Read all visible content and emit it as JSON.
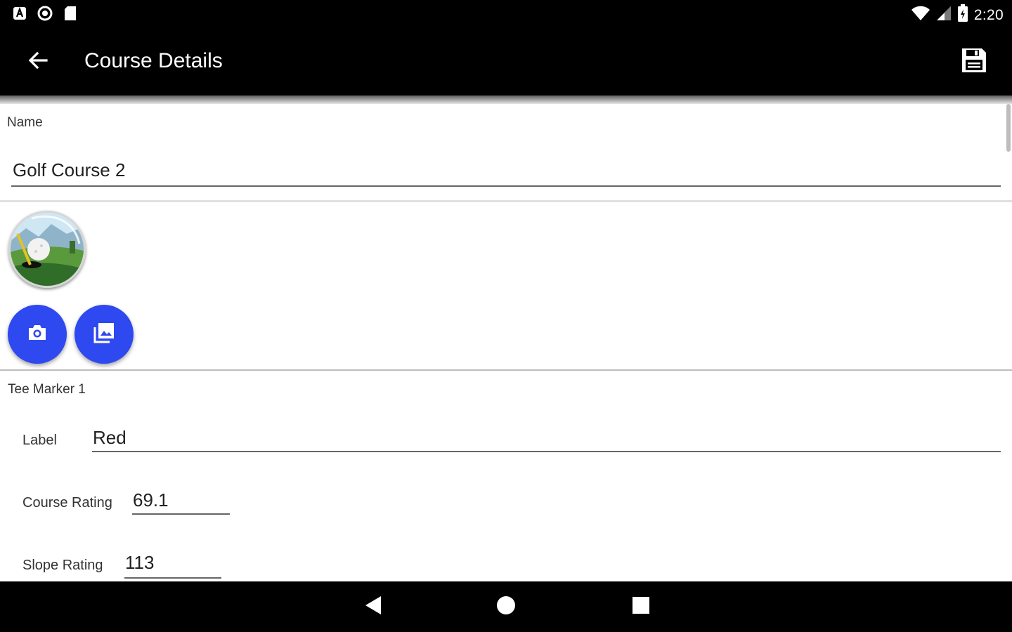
{
  "status_bar": {
    "time": "2:20",
    "left_icons": [
      "notification-a-icon",
      "sync-icon",
      "sd-card-icon"
    ],
    "right_icons": [
      "wifi-icon",
      "cell-signal-icon",
      "battery-icon"
    ]
  },
  "toolbar": {
    "title": "Course Details",
    "back_icon": "arrow-back-icon",
    "save_icon": "save-icon"
  },
  "form": {
    "name_label": "Name",
    "name_value": "Golf Course 2",
    "image_buttons": [
      "camera-icon",
      "gallery-icon"
    ],
    "tee_marker": {
      "section_label": "Tee Marker 1",
      "label_label": "Label",
      "label_value": "Red",
      "course_rating_label": "Course Rating",
      "course_rating_value": "69.1",
      "slope_rating_label": "Slope Rating",
      "slope_rating_value": "113"
    }
  },
  "colors": {
    "accent": "#2f49f0",
    "toolbar": "#000000",
    "background": "#ffffff"
  }
}
